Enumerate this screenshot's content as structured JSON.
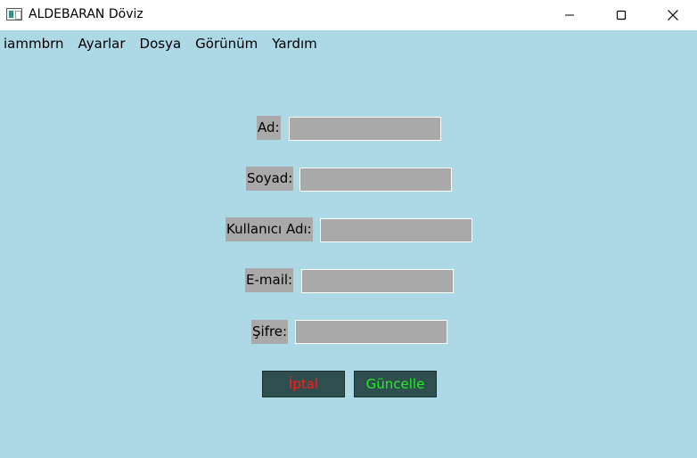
{
  "window": {
    "title": "ALDEBARAN Döviz"
  },
  "menu": {
    "items": [
      "iammbrn",
      "Ayarlar",
      "Dosya",
      "Görünüm",
      "Yardım"
    ]
  },
  "form": {
    "fields": [
      {
        "label": "Ad:",
        "value": ""
      },
      {
        "label": "Soyad:",
        "value": ""
      },
      {
        "label": "Kullanıcı Adı:",
        "value": ""
      },
      {
        "label": "E-mail:",
        "value": ""
      },
      {
        "label": "Şifre:",
        "value": ""
      }
    ],
    "cancel_label": "İptal",
    "update_label": "Güncelle"
  },
  "colors": {
    "background": "#add8e6",
    "field_fill": "#a9a9a9",
    "button_fill": "#2f4f4f",
    "cancel_text": "#ff1a1a",
    "update_text": "#22ee22"
  },
  "icons": {
    "app": "app-window-icon",
    "minimize": "minimize-icon",
    "maximize": "maximize-icon",
    "close": "close-icon"
  }
}
